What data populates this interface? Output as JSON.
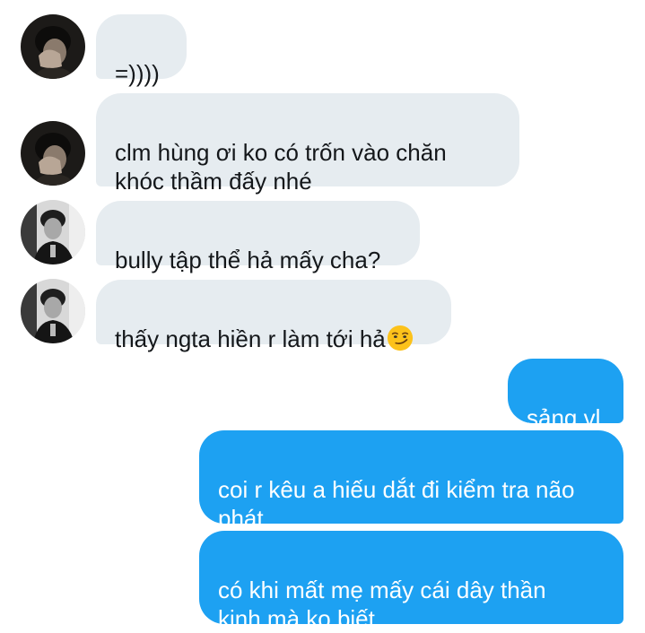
{
  "messages": [
    {
      "side": "received",
      "avatar": "avatar-a",
      "text": "=))))"
    },
    {
      "side": "received",
      "avatar": "avatar-a",
      "text": "clm hùng ơi ko có trốn vào chăn\nkhóc thầm đấy nhé"
    },
    {
      "side": "received",
      "avatar": "avatar-b",
      "text": "bully tập thể hả mấy cha?"
    },
    {
      "side": "received",
      "avatar": "avatar-b",
      "text": "thấy ngta hiền r làm tới hả",
      "emoji": "smirking-face-emoji"
    },
    {
      "side": "sent",
      "text": "sảng vl"
    },
    {
      "side": "sent",
      "text": "coi r kêu a hiếu dắt đi kiểm tra não\nphát"
    },
    {
      "side": "sent",
      "text": "có khi mất mẹ mấy cái dây thần\nkinh mà ko biết"
    }
  ],
  "colors": {
    "received_bubble": "#e6ecf0",
    "received_text": "#14171a",
    "sent_bubble": "#1da1f2",
    "sent_text": "#ffffff"
  }
}
